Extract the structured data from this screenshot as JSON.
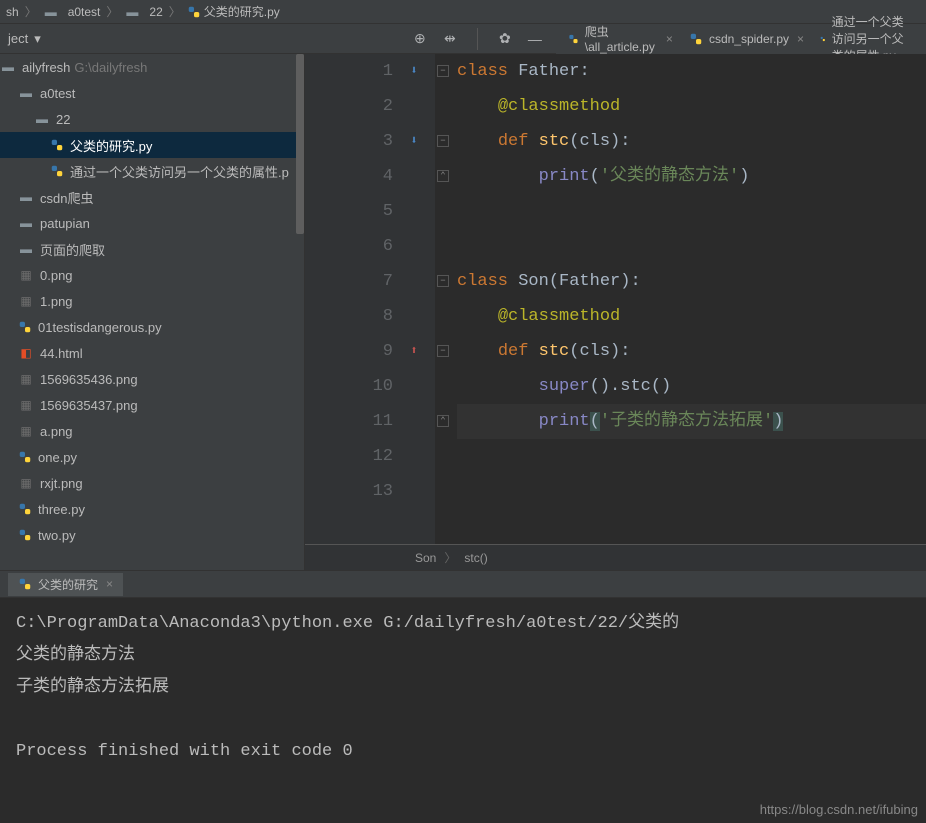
{
  "breadcrumbs": [
    "sh",
    "a0test",
    "22",
    "父类的研究.py"
  ],
  "project_label": "ject",
  "sidebar": {
    "root": {
      "label": "ailyfresh",
      "hint": "G:\\dailyfresh"
    },
    "items": [
      {
        "label": "a0test",
        "indent": 1,
        "icon": "folder"
      },
      {
        "label": "22",
        "indent": 2,
        "icon": "folder"
      },
      {
        "label": "父类的研究.py",
        "indent": 3,
        "icon": "py",
        "selected": true
      },
      {
        "label": "通过一个父类访问另一个父类的属性.p",
        "indent": 3,
        "icon": "py"
      },
      {
        "label": "csdn爬虫",
        "indent": 1,
        "icon": "folder"
      },
      {
        "label": "patupian",
        "indent": 1,
        "icon": "folder"
      },
      {
        "label": "页面的爬取",
        "indent": 1,
        "icon": "folder"
      },
      {
        "label": "0.png",
        "indent": 1,
        "icon": "img"
      },
      {
        "label": "1.png",
        "indent": 1,
        "icon": "img"
      },
      {
        "label": "01testisdangerous.py",
        "indent": 1,
        "icon": "py"
      },
      {
        "label": "44.html",
        "indent": 1,
        "icon": "html"
      },
      {
        "label": "1569635436.png",
        "indent": 1,
        "icon": "img"
      },
      {
        "label": "1569635437.png",
        "indent": 1,
        "icon": "img"
      },
      {
        "label": "a.png",
        "indent": 1,
        "icon": "img"
      },
      {
        "label": "one.py",
        "indent": 1,
        "icon": "py"
      },
      {
        "label": "rxjt.png",
        "indent": 1,
        "icon": "img"
      },
      {
        "label": "three.py",
        "indent": 1,
        "icon": "py"
      },
      {
        "label": "two.py",
        "indent": 1,
        "icon": "py"
      }
    ]
  },
  "tabs": [
    {
      "label": "爬虫\\all_article.py"
    },
    {
      "label": "csdn_spider.py"
    },
    {
      "label": "通过一个父类访问另一个父类的属性.py"
    }
  ],
  "code": {
    "lines": [
      {
        "n": 1,
        "type": "classdef",
        "name": "Father",
        "suffix": ":"
      },
      {
        "n": 2,
        "type": "decorator",
        "text": "@classmethod"
      },
      {
        "n": 3,
        "type": "funcdef",
        "name": "stc",
        "params": "cls"
      },
      {
        "n": 4,
        "type": "print",
        "text": "'父类的静态方法'"
      },
      {
        "n": 5,
        "type": "blank"
      },
      {
        "n": 6,
        "type": "blank"
      },
      {
        "n": 7,
        "type": "classdef2",
        "name": "Son",
        "base": "Father",
        "suffix": ":"
      },
      {
        "n": 8,
        "type": "decorator",
        "text": "@classmethod"
      },
      {
        "n": 9,
        "type": "funcdef",
        "name": "stc",
        "params": "cls"
      },
      {
        "n": 10,
        "type": "super"
      },
      {
        "n": 11,
        "type": "print2",
        "text": "'子类的静态方法拓展'"
      },
      {
        "n": 12,
        "type": "blank"
      },
      {
        "n": 13,
        "type": "blank"
      }
    ],
    "breadcrumb": [
      "Son",
      "stc()"
    ]
  },
  "terminal": {
    "tab": "父类的研究",
    "lines": [
      "C:\\ProgramData\\Anaconda3\\python.exe G:/dailyfresh/a0test/22/父类的",
      "父类的静态方法",
      "子类的静态方法拓展",
      "",
      "Process finished with exit code 0"
    ]
  },
  "watermark": "https://blog.csdn.net/ifubing"
}
